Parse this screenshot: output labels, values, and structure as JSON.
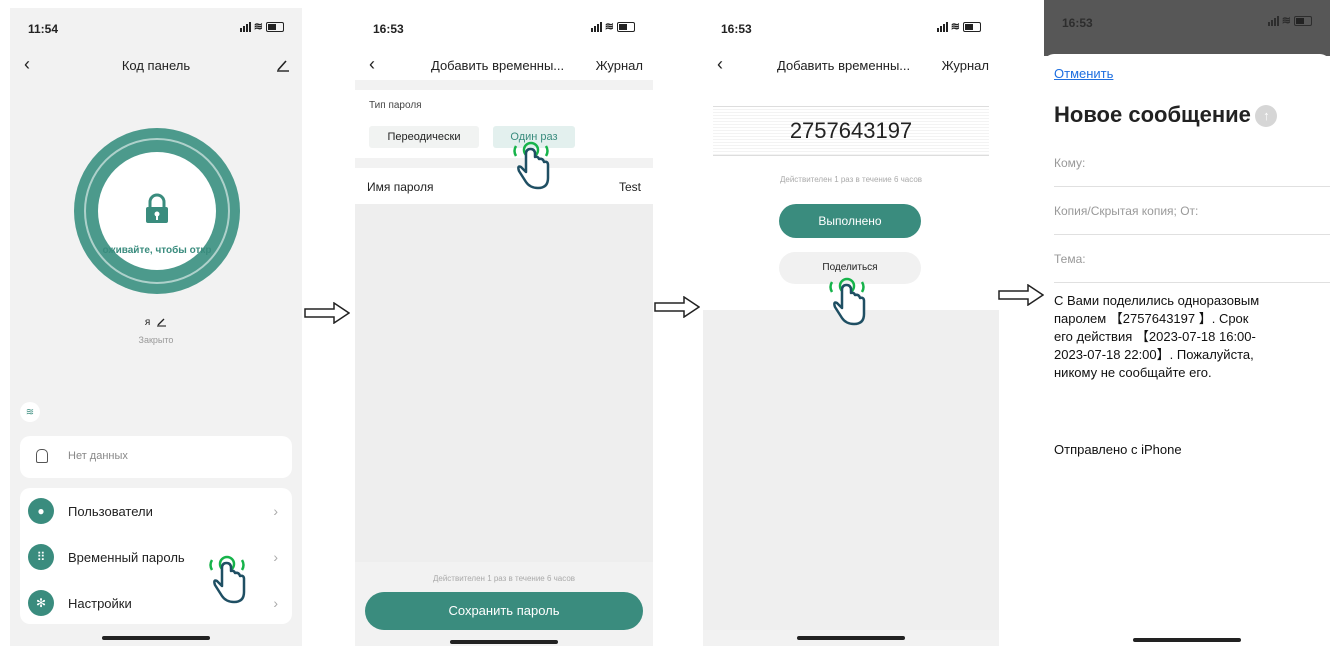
{
  "screen1": {
    "time": "11:54",
    "title": "Код панель",
    "lock_hint": "оживайте, чтобы откр",
    "lock_name": "я",
    "lock_status": "Закрыто",
    "alerts_text": "Нет данных",
    "menu": [
      {
        "label": "Пользователи"
      },
      {
        "label": "Временный пароль"
      },
      {
        "label": "Настройки"
      }
    ]
  },
  "screen2": {
    "time": "16:53",
    "title": "Добавить временны...",
    "journal": "Журнал",
    "type_label": "Тип пароля",
    "type_periodic": "Переодически",
    "type_once": "Один раз",
    "name_label": "Имя пароля",
    "name_value": "Test",
    "validity": "Действителен 1 раз в течение 6 часов",
    "save_button": "Сохранить пароль"
  },
  "screen3": {
    "time": "16:53",
    "title": "Добавить временны...",
    "journal": "Журнал",
    "password": "2757643197",
    "validity": "Действителен 1 раз в течение 6 часов",
    "done_button": "Выполнено",
    "share_button": "Поделиться"
  },
  "screen4": {
    "time": "16:53",
    "cancel": "Отменить",
    "title": "Новое сообщение",
    "to_label": "Кому:",
    "cc_label": "Копия/Скрытая копия; От:",
    "subject_label": "Тема:",
    "body_lines": [
      "С Вами поделились одноразовым",
      "паролем 【2757643197 】. Срок",
      "его действия 【2023-07-18 16:00-",
      "2023-07-18 22:00】. Пожалуйста,",
      "никому не сообщайте его."
    ],
    "signature": "Отправлено с iPhone"
  },
  "colors": {
    "accent": "#3a8c7e",
    "hand_outline": "#1f4f63",
    "tap_green": "#16b34a",
    "link": "#1e6fe0"
  }
}
